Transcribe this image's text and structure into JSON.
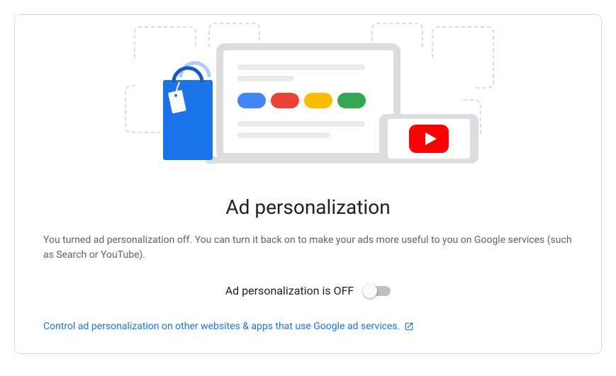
{
  "card": {
    "title": "Ad personalization",
    "description": "You turned ad personalization off. You can turn it back on to make your ads more useful to you on Google services (such as Search or YouTube).",
    "toggle": {
      "label": "Ad personalization is OFF",
      "state": "off"
    },
    "link": {
      "text": "Control ad personalization on other websites & apps that use Google ad services."
    }
  }
}
